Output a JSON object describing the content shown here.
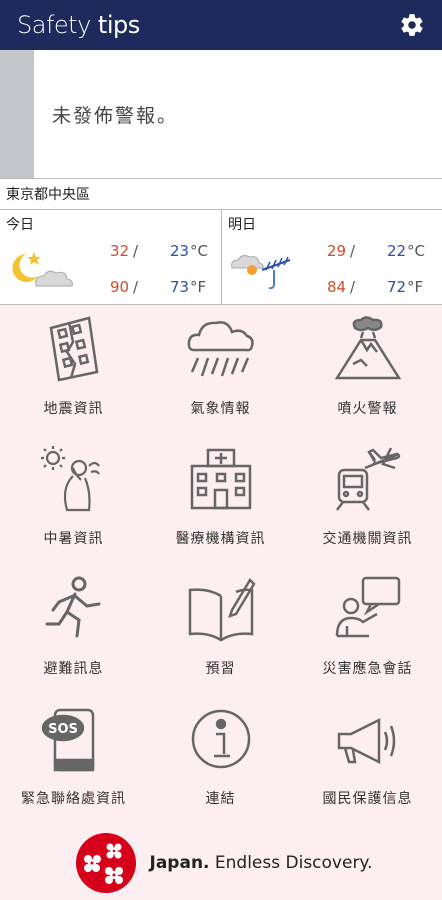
{
  "header": {
    "title_part1": "Safety",
    "title_part2": " tips",
    "settings_icon": "gear-icon"
  },
  "alert": {
    "message": "未發佈警報。"
  },
  "weather": {
    "location": "東京都中央區",
    "today": {
      "label": "今日",
      "icon": "moon-cloud-icon",
      "high_c": "32",
      "low_c": "23",
      "high_f": "90",
      "low_f": "73",
      "unit_c": "°C",
      "unit_f": "°F",
      "sep": "/"
    },
    "tomorrow": {
      "label": "明日",
      "icon": "cloud-sun-rain-icon",
      "high_c": "29",
      "low_c": "22",
      "high_f": "84",
      "low_f": "72",
      "unit_c": "°C",
      "unit_f": "°F",
      "sep": "/"
    }
  },
  "menu": [
    {
      "label": "地震資訊",
      "icon": "earthquake-building-icon"
    },
    {
      "label": "氣象情報",
      "icon": "rain-cloud-icon"
    },
    {
      "label": "噴火警報",
      "icon": "volcano-icon"
    },
    {
      "label": "中暑資訊",
      "icon": "heatstroke-icon"
    },
    {
      "label": "醫療機構資訊",
      "icon": "hospital-icon"
    },
    {
      "label": "交通機關資訊",
      "icon": "train-plane-icon"
    },
    {
      "label": "避難訊息",
      "icon": "running-person-icon"
    },
    {
      "label": "預習",
      "icon": "open-book-icon"
    },
    {
      "label": "災害應急會話",
      "icon": "speaking-person-icon"
    },
    {
      "label": "緊急聯絡處資訊",
      "icon": "sos-phone-icon"
    },
    {
      "label": "連結",
      "icon": "info-icon"
    },
    {
      "label": "國民保護信息",
      "icon": "megaphone-icon"
    }
  ],
  "footer": {
    "brand": "Japan.",
    "tagline": " Endless Discovery."
  },
  "colors": {
    "header_bg": "#1f2a5c",
    "page_bg": "#fdeef1",
    "temp_high": "#d44a2a",
    "temp_low": "#2b4fb0",
    "logo_red": "#d7001a"
  }
}
